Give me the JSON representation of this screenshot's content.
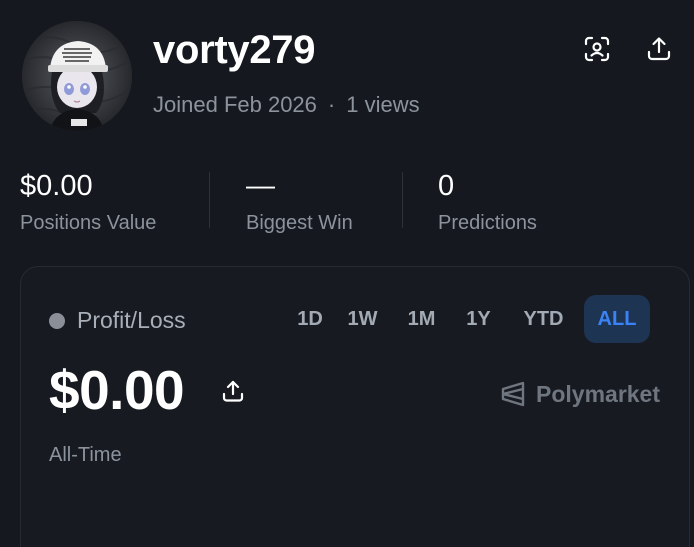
{
  "profile": {
    "username": "vorty279",
    "joined": "Joined Feb 2026",
    "separator": "·",
    "views": "1 views",
    "avatar_icon": "anime-character-avatar"
  },
  "header_actions": {
    "scan_icon": "face-scan-icon",
    "share_icon": "share-upload-icon"
  },
  "stats": [
    {
      "value": "$0.00",
      "label": "Positions Value"
    },
    {
      "value": "—",
      "label": "Biggest Win"
    },
    {
      "value": "0",
      "label": "Predictions"
    }
  ],
  "pnl": {
    "label": "Profit/Loss",
    "value": "$0.00",
    "period": "All-Time",
    "brand": "Polymarket",
    "ranges": [
      "1D",
      "1W",
      "1M",
      "1Y",
      "YTD",
      "ALL"
    ],
    "selected_range": "ALL"
  },
  "colors": {
    "background": "#15191f",
    "accent": "#3b82f6",
    "accent_bg": "#1e3453",
    "muted_text": "#8c939d"
  }
}
